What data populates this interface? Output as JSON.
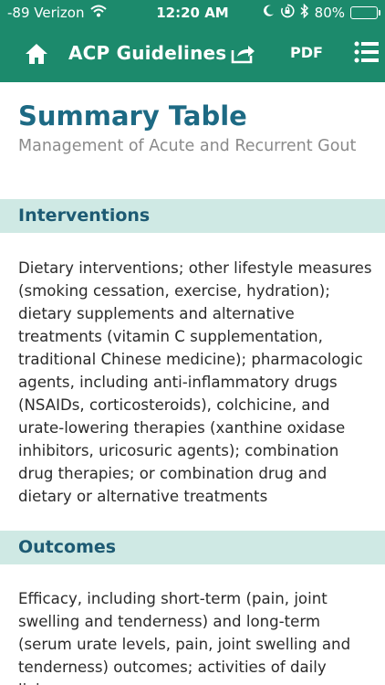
{
  "status_bar": {
    "carrier": "-89 Verizon",
    "time": "12:20 AM",
    "battery": "80%",
    "battery_level": 0.8,
    "icons": [
      "wifi-icon",
      "moon-icon",
      "rotation-lock-icon",
      "bluetooth-icon",
      "battery-icon"
    ]
  },
  "nav": {
    "title": "ACP Guidelines",
    "pdf_label": "PDF",
    "icons": [
      "home-icon",
      "share-icon",
      "list-menu-icon"
    ]
  },
  "page": {
    "title": "Summary Table",
    "subtitle": "Management of Acute and Recurrent Gout"
  },
  "sections": [
    {
      "header": "Interventions",
      "body": "Dietary interventions; other lifestyle measures (smoking cessation, exercise, hydration); dietary supplements and alternative treatments (vitamin C supplementation, traditional Chinese medicine); pharmacologic agents, including anti-inflammatory drugs (NSAIDs, corticosteroids), colchicine, and urate-lowering therapies (xanthine oxidase inhibitors, uricosuric agents); combination drug therapies; or combination drug and dietary or alternative treatments"
    },
    {
      "header": "Outcomes",
      "body": "Efficacy, including short-term (pain, joint swelling and tenderness) and long-term (serum urate levels, pain, joint swelling and tenderness) outcomes; activities of daily living;"
    }
  ],
  "colors": {
    "nav_bg": "#1c8a6c",
    "title": "#1d6a84",
    "section_bg": "#cfe9e4",
    "section_text": "#1d5a73"
  }
}
